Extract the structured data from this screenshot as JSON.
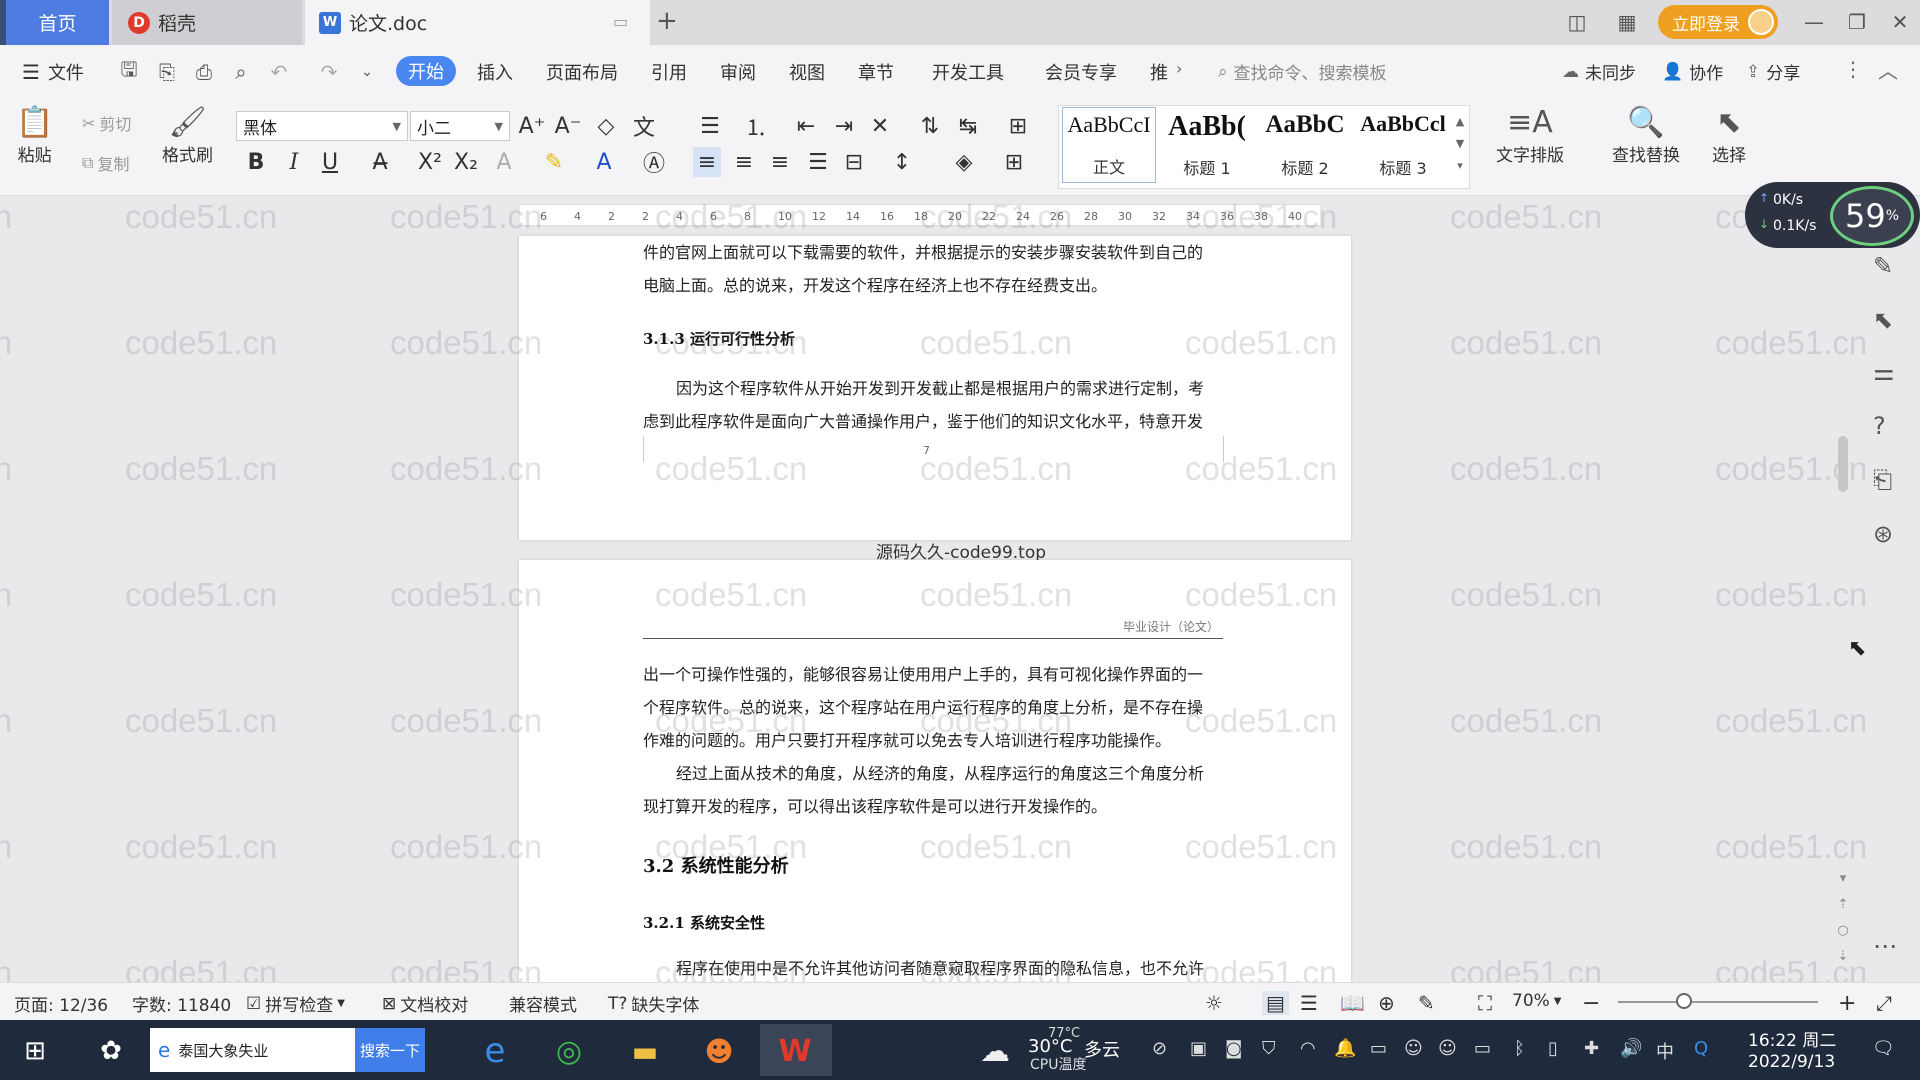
{
  "tabs": {
    "home": "首页",
    "daoke": "稻壳",
    "doc": "论文.doc"
  },
  "titlebar": {
    "login": "立即登录"
  },
  "menu": {
    "file": "文件",
    "items": [
      "开始",
      "插入",
      "页面布局",
      "引用",
      "审阅",
      "视图",
      "章节",
      "开发工具",
      "会员专享",
      "推"
    ],
    "search_cmd": "查找命令、搜索模板",
    "unsynced": "未同步",
    "collab": "协作",
    "share": "分享"
  },
  "ribbon": {
    "paste": "粘贴",
    "cut": "剪切",
    "copy": "复制",
    "format_painter": "格式刷",
    "font": "黑体",
    "size": "小二",
    "styles": [
      {
        "preview": "AaBbCcI",
        "label": "正文"
      },
      {
        "preview": "AaBb(",
        "label": "标题 1"
      },
      {
        "preview": "AaBbC",
        "label": "标题 2"
      },
      {
        "preview": "AaBbCcl",
        "label": "标题 3"
      }
    ],
    "text_layout": "文字排版",
    "find_replace": "查找替换",
    "select": "选择"
  },
  "ruler": {
    "ticks": [
      "6",
      "4",
      "2",
      "2",
      "4",
      "6",
      "8",
      "10",
      "12",
      "14",
      "16",
      "18",
      "20",
      "22",
      "24",
      "26",
      "28",
      "30",
      "32",
      "34",
      "36",
      "38",
      "40"
    ]
  },
  "page1": {
    "line1": "件的官网上面就可以下载需要的软件，并根据提示的安装步骤安装软件到自己的",
    "line2": "电脑上面。总的说来，开发这个程序在经济上也不存在经费支出。",
    "heading": "3.1.3  运行可行性分析",
    "para1": "因为这个程序软件从开始开发到开发截止都是根据用户的需求进行定制，考",
    "para2": "虑到此程序软件是面向广大普通操作用户，鉴于他们的知识文化水平，特意开发",
    "page_num": "7"
  },
  "gap_text": "源码久久-code99.top",
  "page2": {
    "header": "毕业设计（论文）",
    "p1l1": "出一个可操作性强的，能够很容易让使用用户上手的，具有可视化操作界面的一",
    "p1l2": "个程序软件。总的说来，这个程序站在用户运行程序的角度上分析，是不存在操",
    "p1l3": "作难的问题的。用户只要打开程序就可以免去专人培训进行程序功能操作。",
    "p2l1": "经过上面从技术的角度，从经济的角度，从程序运行的角度这三个角度分析",
    "p2l2": "现打算开发的程序，可以得出该程序软件是可以进行开发操作的。",
    "h2": "3.2 系统性能分析",
    "h3": "3.2.1  系统安全性",
    "cut": "程序在使用中是不允许其他访问者随意窥取程序界面的隐私信息，也不允许"
  },
  "watermark": "code51.cn",
  "speed": {
    "up": "0K/s",
    "down": "0.1K/s",
    "percent": "59",
    "pct_sign": "%"
  },
  "status": {
    "page": "页面: 12/36",
    "words": "字数: 11840",
    "spell": "拼写检查",
    "proof": "文档校对",
    "compat": "兼容模式",
    "missing_font": "缺失字体",
    "zoom": "70%"
  },
  "taskbar": {
    "search_text": "泰国大象失业",
    "search_btn": "搜索一下",
    "weather_temp": "30°C",
    "weather_desc": "多云",
    "cpu_temp": "77°C",
    "cpu_label": "CPU温度",
    "ime": "中",
    "time": "16:22 周二",
    "date": "2022/9/13"
  }
}
